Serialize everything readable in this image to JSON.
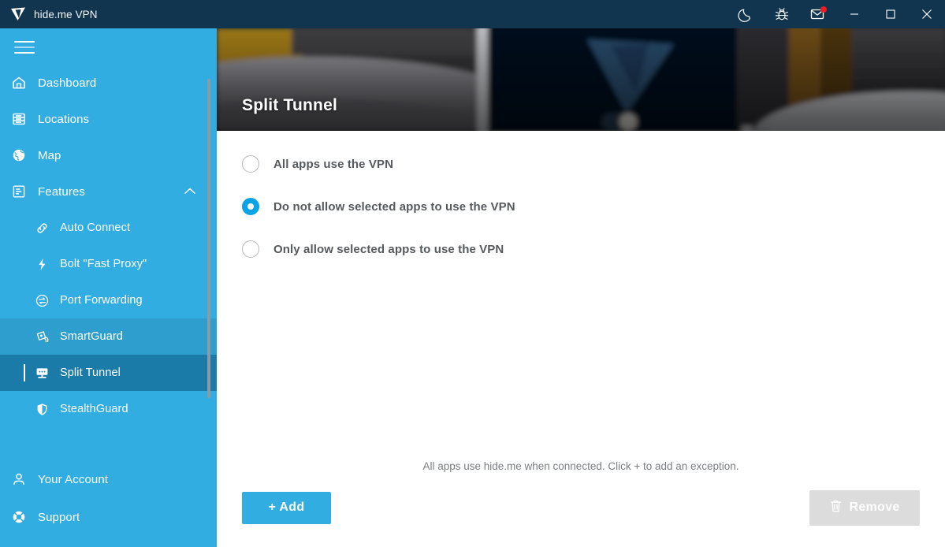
{
  "titlebar": {
    "app_title": "hide.me VPN",
    "logo_icon": "hideme-triangle-logo-icon",
    "buttons": [
      {
        "name": "night-mode-button",
        "icon": "moon-icon",
        "label": ""
      },
      {
        "name": "report-bug-button",
        "icon": "bug-icon",
        "label": ""
      },
      {
        "name": "messages-button",
        "icon": "envelope-icon",
        "label": "",
        "badge": true
      },
      {
        "name": "minimize-button",
        "icon": "minimize-icon",
        "label": ""
      },
      {
        "name": "maximize-button",
        "icon": "maximize-icon",
        "label": ""
      },
      {
        "name": "close-button",
        "icon": "close-icon",
        "label": ""
      }
    ],
    "background_color": "#12354f"
  },
  "sidebar": {
    "background_color": "#32ade1",
    "active_color": "#1a7ba8",
    "hover_color": "#2d9ecd",
    "menu_toggle_icon": "hamburger-menu-icon",
    "items": [
      {
        "label": "Dashboard",
        "icon": "home-icon",
        "state": "normal"
      },
      {
        "label": "Locations",
        "icon": "list-server-icon",
        "state": "normal"
      },
      {
        "label": "Map",
        "icon": "globe-icon",
        "state": "normal"
      },
      {
        "label": "Features",
        "icon": "document-list-icon",
        "state": "expanded",
        "chevron": "chevron-up-icon"
      }
    ],
    "features_subitems": [
      {
        "label": "Auto Connect",
        "icon": "link-icon",
        "state": "normal"
      },
      {
        "label": "Bolt \"Fast Proxy\"",
        "icon": "bolt-icon",
        "state": "normal"
      },
      {
        "label": "Port Forwarding",
        "icon": "port-forwarding-icon",
        "state": "normal"
      },
      {
        "label": "SmartGuard",
        "icon": "smartguard-icon",
        "state": "hovered"
      },
      {
        "label": "Split Tunnel",
        "icon": "monitor-icon",
        "state": "active"
      },
      {
        "label": "StealthGuard",
        "icon": "shield-icon",
        "state": "normal"
      }
    ],
    "bottom_items": [
      {
        "label": "Your Account",
        "icon": "user-icon",
        "state": "normal"
      },
      {
        "label": "Support",
        "icon": "lifebuoy-icon",
        "state": "normal"
      }
    ],
    "scrollbar": {
      "name": "sidebar-scrollbar",
      "visible": true
    }
  },
  "hero": {
    "title": "Split Tunnel",
    "background": "photo-living-room-with-laptop"
  },
  "options": {
    "selected_index": 1,
    "items": [
      {
        "label": "All apps use the VPN",
        "selected": false
      },
      {
        "label": "Do not allow selected apps to use the VPN",
        "selected": true
      },
      {
        "label": "Only allow selected apps to use the VPN",
        "selected": false
      }
    ],
    "accent_color": "#0aa3e8"
  },
  "empty_state": {
    "message": "All apps use hide.me when connected. Click + to add an exception."
  },
  "footer": {
    "add_label": "+ Add",
    "add_color": "#32ade1",
    "remove_label": "Remove",
    "remove_icon": "trash-icon",
    "remove_disabled": true,
    "remove_color": "#dcdcdc"
  }
}
